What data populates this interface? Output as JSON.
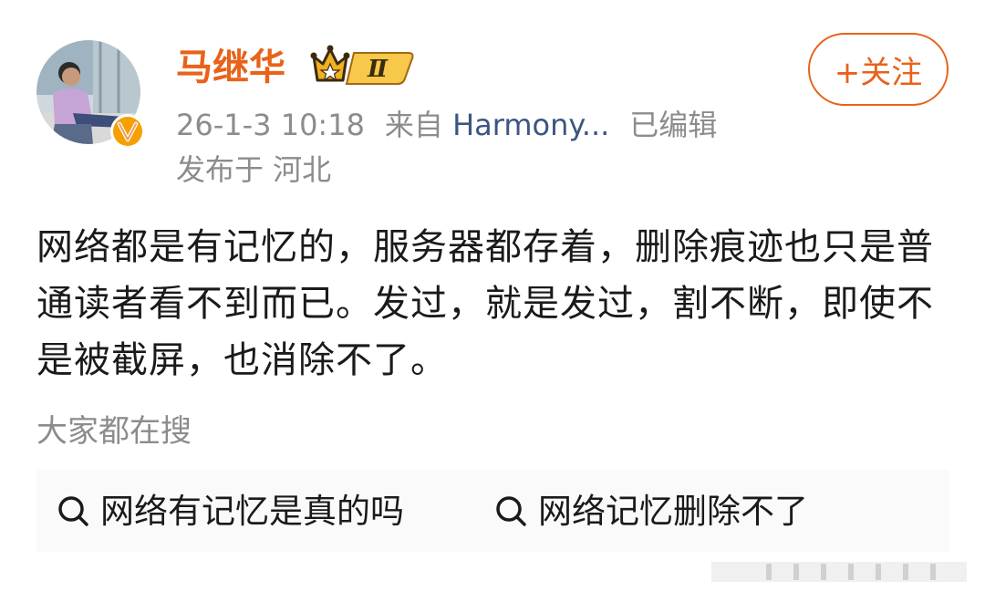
{
  "post": {
    "username": "马继华",
    "vip_level": "Ⅱ",
    "timestamp": "26-1-3 10:18",
    "source_prefix": "来自",
    "source_device": "Harmony...",
    "edited": "已编辑",
    "location": "发布于 河北",
    "follow_label": "+关注",
    "content": "网络都是有记忆的，服务器都存着，删除痕迹也只是普通读者看不到而已。发过，就是发过，割不断，即使不是被截屏，也消除不了。"
  },
  "hot_search": {
    "title": "大家都在搜",
    "items": [
      "网络有记忆是真的吗",
      "网络记忆删除不了"
    ]
  },
  "colors": {
    "accent": "#e8621a",
    "meta_text": "#8c8c8c",
    "device_link": "#3c5582",
    "body_text": "#1a1a1a"
  },
  "icons": [
    "avatar",
    "verified-v-icon",
    "vip-crown-icon",
    "search-icon"
  ]
}
